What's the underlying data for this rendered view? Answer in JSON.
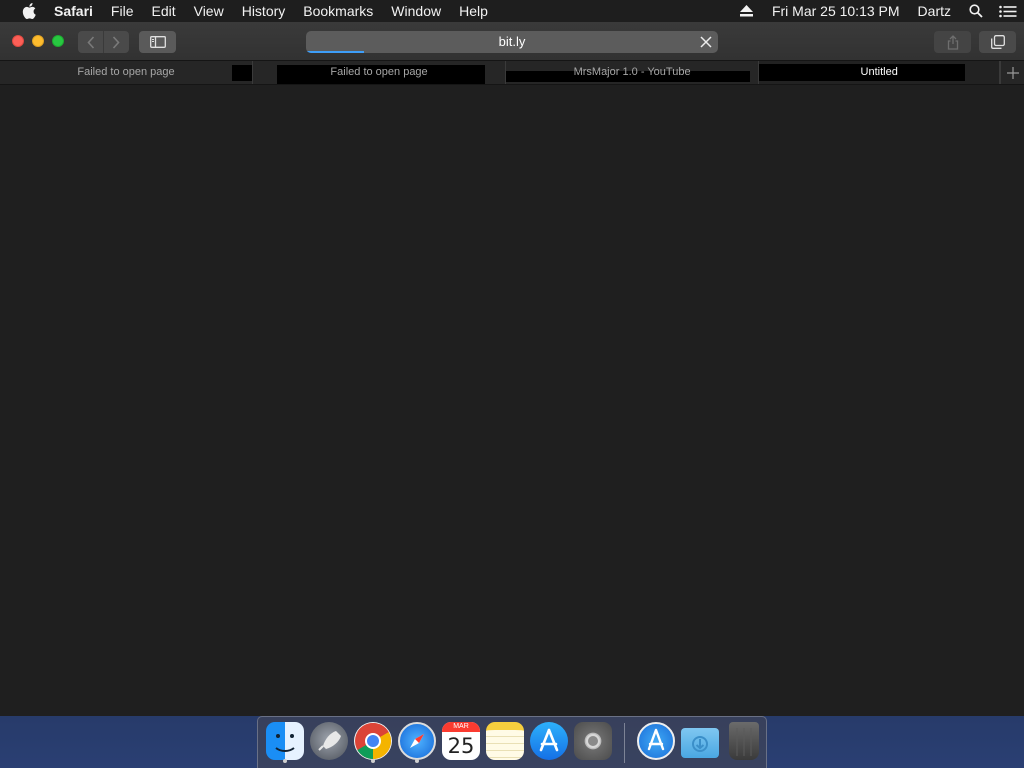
{
  "menubar": {
    "app_name": "Safari",
    "menus": [
      "File",
      "Edit",
      "View",
      "History",
      "Bookmarks",
      "Window",
      "Help"
    ],
    "datetime": "Fri Mar 25  10:13 PM",
    "user": "Dartz",
    "icons": [
      "apple-icon",
      "eject-icon",
      "spotlight-icon",
      "notification-center-icon"
    ]
  },
  "toolbar": {
    "url": "bit.ly",
    "page_load_progress": 0.14,
    "progress_color": "#3e9ef8"
  },
  "tabs": [
    {
      "title": "Failed to open page",
      "active": false
    },
    {
      "title": "Failed to open page",
      "active": false
    },
    {
      "title": "MrsMajor 1.0 - YouTube",
      "active": false
    },
    {
      "title": "Untitled",
      "active": true
    }
  ],
  "dock": {
    "apps": [
      "Finder",
      "Launchpad",
      "Google Chrome",
      "Safari",
      "Calendar",
      "Notes",
      "App Store",
      "System Preferences",
      "App Store",
      "Downloads",
      "Trash"
    ],
    "calendar": {
      "month": "MAR",
      "day": "25"
    },
    "running": [
      "Finder",
      "Google Chrome",
      "Safari"
    ]
  },
  "colors": {
    "close": "#fc5f57",
    "minimize": "#fdbc2e",
    "maximize": "#28c841",
    "content_background": "#1f1f1f"
  }
}
